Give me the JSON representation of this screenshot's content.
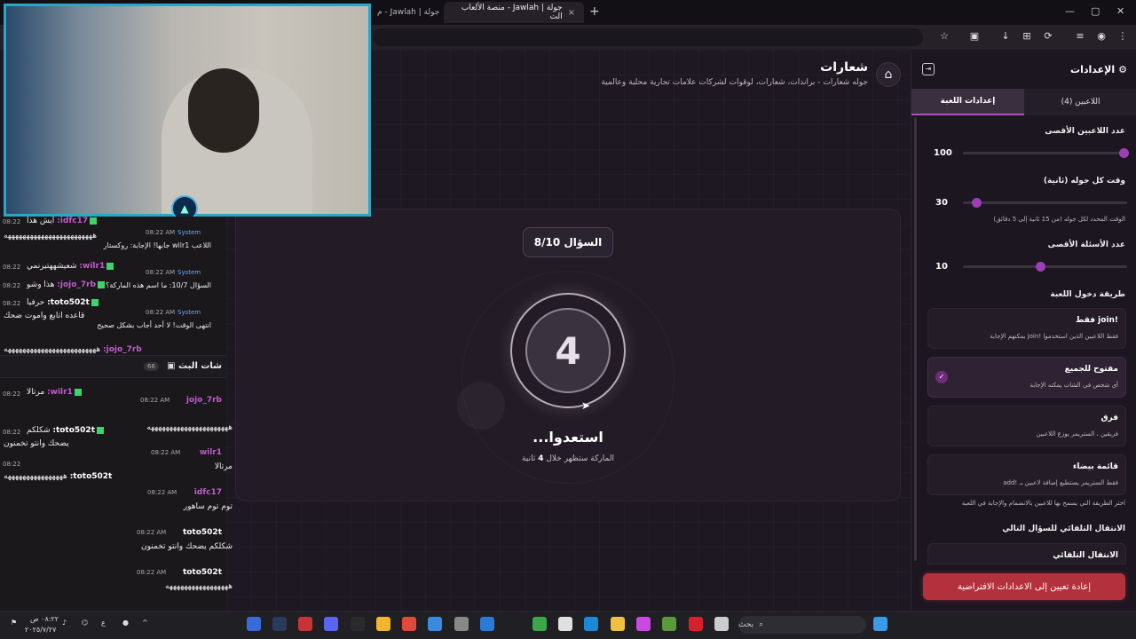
{
  "browser": {
    "tabs": [
      {
        "label": "جولة | Jawlah - م"
      },
      {
        "label": "جولة | Jawlah - منصة الألعاب الت"
      }
    ],
    "tab_close": "×",
    "new_tab": "+",
    "win_min": "—",
    "win_max": "▢",
    "win_close": "✕"
  },
  "header": {
    "title": "شعارات",
    "subtitle": "جوله شعارات - براندات، شعارات، لوقوات لشركات علامات تجارية محلية وعالمية",
    "home_icon": "⌂"
  },
  "game": {
    "question_badge": "السؤال 8/10",
    "countdown": "4",
    "ready_title": "استعدوا...",
    "ready_sub_prefix": "الماركة ستظهر خلال",
    "ready_sub_seconds": "4",
    "ready_sub_suffix": "ثانية"
  },
  "settings": {
    "title": "الإعدادات",
    "gear_icon": "⚙",
    "tabs": {
      "players": "اللاعبين (4)",
      "game_settings": "إعدادات اللعبة"
    },
    "max_players": {
      "label": "عدد اللاعبين الأقصى",
      "value": "100",
      "fraction": 0.02
    },
    "round_time": {
      "label": "وقت كل جوله (ثانية)",
      "value": "30",
      "fraction": 0.92,
      "hint": "الوقت المحدد لكل جوله (من 15 ثانية إلى 5 دقائق)"
    },
    "max_questions": {
      "label": "عدد الأسئلة الأقصى",
      "value": "10",
      "fraction": 0.53
    },
    "join_method_label": "طريقة دخول اللعبة",
    "join_options": [
      {
        "title": "!join فقط",
        "desc": "فقط اللاعبين الذين استخدموا !join يمكنهم الإجابة",
        "selected": false
      },
      {
        "title": "مفتوح للجميع",
        "desc": "أي شخص في الشات يمكنه الإجابة",
        "selected": true
      },
      {
        "title": "فرق",
        "desc": "فريقين ، الستريمر يوزع اللاعبين",
        "selected": false
      },
      {
        "title": "قائمة بيضاء",
        "desc": "فقط الستريمر يستطيع إضافة لاعبين بـ !add",
        "selected": false
      }
    ],
    "join_hint": "اختر الطريقة التي يسمح بها للاعبين بالانضمام والإجابة في اللعبة",
    "auto_next_label": "الانتقال التلقائي للسؤال التالي",
    "auto_next_option": "الانتقال التلقائي",
    "reset_button": "إعادة تعيين إلى الاعدادات الافتراضية",
    "check_icon": "✓"
  },
  "chat_top": [
    {
      "time": "08:22",
      "user": "idfc17:",
      "text": "ايش هذا"
    },
    {
      "time": "",
      "user": "",
      "text": "ههههههههههههههههههههههههه"
    },
    {
      "time": "08:22",
      "user": "wilr1:",
      "text": "شعيشههتيرنمي"
    },
    {
      "time": "08:22",
      "user": "jojo_7rb:",
      "text": "هذا وشو"
    },
    {
      "time": "08:22",
      "user": "toto502t:",
      "text": "حرفيا"
    },
    {
      "time": "",
      "user": "",
      "text": "قاعده اتابع واموت ضحك"
    },
    {
      "time": "08:22",
      "user": "jojo_7rb:",
      "text": "هههههههههههههههههههههههههه"
    }
  ],
  "chat_system": [
    {
      "time": "08:22 AM",
      "label": "System",
      "text": "اللاعب wilr1 جابها! الإجابة: روكستار"
    },
    {
      "time": "08:22 AM",
      "label": "System",
      "text": "السؤال 10/7: ما اسم هذه الماركة؟"
    },
    {
      "time": "08:22 AM",
      "label": "System",
      "text": "انتهى الوقت! لا أحد أجاب بشكل صحيح"
    }
  ],
  "chat_panel": {
    "title": "شات البث",
    "count": "66",
    "messages": [
      {
        "time": "08:22 AM",
        "user": "jojo_7rb",
        "text": "ههههههههههههههههههههههه"
      },
      {
        "time": "08:22 AM",
        "user": "wilr1",
        "text": "مرتالا"
      },
      {
        "time": "08:22 AM",
        "user": "idfc17",
        "text": "توم توم ساهور"
      },
      {
        "time": "08:22 AM",
        "user": "toto502t",
        "text": "شكلكم يضحك وانتو تخمنون"
      },
      {
        "time": "08:22 AM",
        "user": "toto502t",
        "text": "هههههههههههههههههه"
      }
    ]
  },
  "chat_left": [
    {
      "time": "08:22",
      "user": "wilr1:",
      "text": "مرتالا"
    },
    {
      "time": "08:22",
      "user": "toto502t:",
      "text": "شكلكم"
    },
    {
      "time": "",
      "user": "",
      "text": "يضحك وانتو تخمنون"
    },
    {
      "time": "08:22",
      "user": "toto502t:",
      "text": "ههههههههههههههههه"
    }
  ],
  "taskbar": {
    "search_placeholder": "بحث",
    "search_icon": "⌕",
    "clock_time": "٠٨:٢٢ ص",
    "clock_date": "٢٠٢٥/٧/٢٧",
    "lang": "ع"
  },
  "colors": {
    "accent": "#9c3fb4",
    "danger": "#b3313c",
    "cam_border": "#2aa6c9"
  }
}
